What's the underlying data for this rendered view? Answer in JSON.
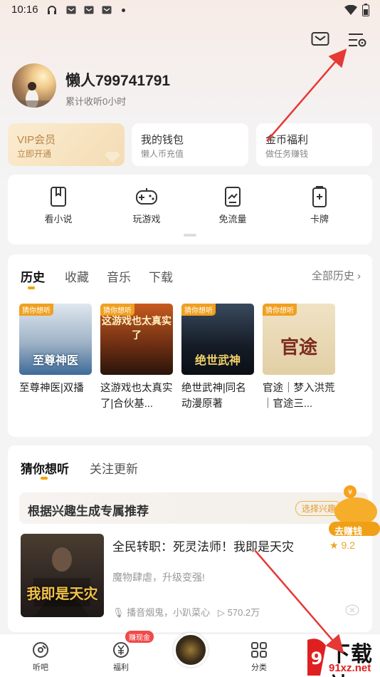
{
  "status_bar": {
    "time": "10:16"
  },
  "profile": {
    "username": "懒人799741791",
    "listen_time": "累计收听0小时"
  },
  "quick_cards": [
    {
      "title": "VIP会员",
      "subtitle": "立即开通"
    },
    {
      "title": "我的钱包",
      "subtitle": "懒人币充值"
    },
    {
      "title": "金币福利",
      "subtitle": "做任务赚钱"
    }
  ],
  "tools": [
    {
      "label": "看小说",
      "icon": "book-icon"
    },
    {
      "label": "玩游戏",
      "icon": "gamepad-icon"
    },
    {
      "label": "免流量",
      "icon": "data-card-icon"
    },
    {
      "label": "卡牌",
      "icon": "card-icon"
    }
  ],
  "history": {
    "tabs": [
      "历史",
      "收藏",
      "音乐",
      "下载"
    ],
    "all_label": "全部历史",
    "books": [
      {
        "tag": "猜你想听",
        "cover_text": "至尊神医",
        "title": "至尊神医|双播"
      },
      {
        "tag": "猜你想听",
        "cover_text": "这游戏也太真实了",
        "title": "这游戏也太真实了|合伙基..."
      },
      {
        "tag": "猜你想听",
        "cover_text": "绝世武神",
        "title": "绝世武神|同名动漫原著"
      },
      {
        "tag": "猜你想听",
        "cover_text": "官途",
        "title": "官途｜梦入洪荒｜官途三..."
      }
    ]
  },
  "recommend": {
    "tabs": [
      "猜你想听",
      "关注更新"
    ],
    "banner_text": "根据兴趣生成专属推荐",
    "banner_button": "选择兴趣",
    "item": {
      "cover_text": "我即是天灾",
      "title": "全民转职：死灵法师！我即是天灾",
      "rating": "9.2",
      "desc": "魔物肆虐，升级变强!",
      "narrators": "播音烟鬼，小趴菜心",
      "plays": "570.2万"
    }
  },
  "float_button": "去赚钱",
  "bottom_nav": [
    {
      "label": "听吧"
    },
    {
      "label": "福利",
      "badge": "赚现金"
    },
    {
      "label": ""
    },
    {
      "label": "分类"
    }
  ],
  "watermark": {
    "line1": "下载站",
    "line2": "91xz.net"
  },
  "colors": {
    "accent": "#f5a300",
    "vip_text": "#b98648",
    "arrow": "#e53935"
  }
}
